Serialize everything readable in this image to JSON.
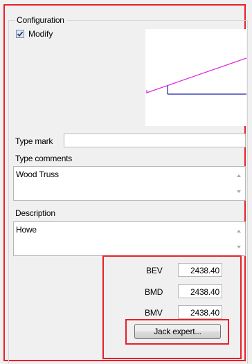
{
  "configuration": {
    "group_title": "Configuration",
    "modify_label": "Modify",
    "modify_checked": true
  },
  "type_mark": {
    "label": "Type mark",
    "value": ""
  },
  "type_comments": {
    "label": "Type comments",
    "value": "Wood Truss"
  },
  "description": {
    "label": "Description",
    "value": "Howe"
  },
  "parameters": [
    {
      "label": "BEV",
      "value": "2438.40"
    },
    {
      "label": "BMD",
      "value": "2438.40"
    },
    {
      "label": "BMV",
      "value": "2438.40"
    }
  ],
  "jack_button_label": "Jack expert...",
  "colors": {
    "highlight_border": "#e8202a",
    "preview_top_chord": "#e020e0",
    "preview_bottom_chord": "#1a1ab0"
  }
}
